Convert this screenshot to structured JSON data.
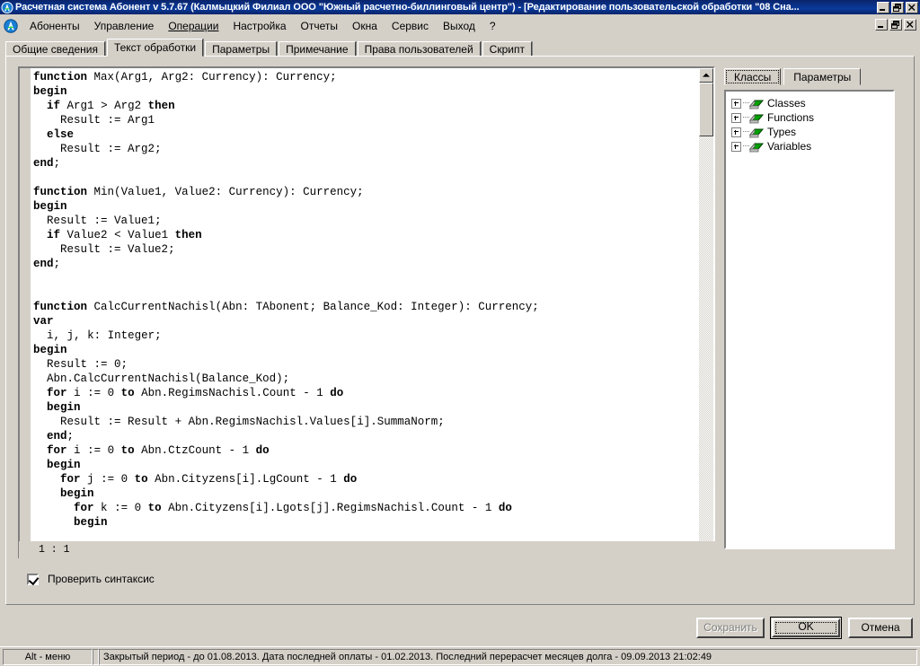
{
  "window": {
    "title": "Расчетная система Абонент v 5.7.67 (Калмыцкий Филиал ООО \"Южный расчетно-биллинговый центр\") - [Редактирование пользовательской обработки \"08 Сна...",
    "app_icon": "abonent-logo-icon",
    "controls": {
      "minimize": "_",
      "restore": "❐",
      "close": "✕"
    }
  },
  "mdi_controls": {
    "minimize": "_",
    "restore": "❐",
    "close": "✕"
  },
  "menu": {
    "icon": "abonent-logo-icon",
    "items": [
      {
        "label": "Абоненты",
        "underlined": false
      },
      {
        "label": "Управление",
        "underlined": false
      },
      {
        "label": "Операции",
        "underlined": true
      },
      {
        "label": "Настройка",
        "underlined": false
      },
      {
        "label": "Отчеты",
        "underlined": false
      },
      {
        "label": "Окна",
        "underlined": false
      },
      {
        "label": "Сервис",
        "underlined": false
      },
      {
        "label": "Выход",
        "underlined": false
      },
      {
        "label": "?",
        "underlined": false
      }
    ]
  },
  "tabs": [
    {
      "label": "Общие сведения",
      "active": false
    },
    {
      "label": "Текст обработки",
      "active": true
    },
    {
      "label": "Параметры",
      "active": false
    },
    {
      "label": "Примечание",
      "active": false
    },
    {
      "label": "Права пользователей",
      "active": false
    },
    {
      "label": "Скрипт",
      "active": false
    }
  ],
  "editor": {
    "code": "function Max(Arg1, Arg2: Currency): Currency;\nbegin\n  if Arg1 > Arg2 then\n    Result := Arg1\n  else\n    Result := Arg2;\nend;\n\nfunction Min(Value1, Value2: Currency): Currency;\nbegin\n  Result := Value1;\n  if Value2 < Value1 then\n    Result := Value2;\nend;\n\n\nfunction CalcCurrentNachisl(Abn: TAbonent; Balance_Kod: Integer): Currency;\nvar\n  i, j, k: Integer;\nbegin\n  Result := 0;\n  Abn.CalcCurrentNachisl(Balance_Kod);\n  for i := 0 to Abn.RegimsNachisl.Count - 1 do\n  begin\n    Result := Result + Abn.RegimsNachisl.Values[i].SummaNorm;\n  end;\n  for i := 0 to Abn.CtzCount - 1 do\n  begin\n    for j := 0 to Abn.Cityzens[i].LgCount - 1 do\n    begin\n      for k := 0 to Abn.Cityzens[i].Lgots[j].RegimsNachisl.Count - 1 do\n      begin",
    "caret_position": "1 : 1",
    "scrollbar": {
      "up_arrow": "▲",
      "down_arrow": "▼"
    }
  },
  "right_panel": {
    "tabs": [
      {
        "label": "Классы",
        "active": true
      },
      {
        "label": "Параметры",
        "active": false
      }
    ],
    "tree": [
      {
        "label": "Classes",
        "icon": "book-icon",
        "expander": "plus"
      },
      {
        "label": "Functions",
        "icon": "book-icon",
        "expander": "plus"
      },
      {
        "label": "Types",
        "icon": "book-icon",
        "expander": "plus"
      },
      {
        "label": "Variables",
        "icon": "book-icon",
        "expander": "plus"
      }
    ]
  },
  "check_syntax": {
    "label": "Проверить синтаксис",
    "checked": true
  },
  "buttons": {
    "save": {
      "label": "Сохранить",
      "disabled": true
    },
    "ok": {
      "label": "OK",
      "default": true
    },
    "cancel": {
      "label": "Отмена",
      "disabled": false
    }
  },
  "statusbar": {
    "hint": "Alt - меню",
    "info": "Закрытый период - до 01.08.2013. Дата последней оплаты - 01.02.2013. Последний перерасчет месяцев долга - 09.09.2013 21:02:49"
  },
  "colors": {
    "titlebar": "#0a246a",
    "face": "#d4d0c8",
    "editor_bg": "#ffffff",
    "book_icon": "#008000"
  }
}
